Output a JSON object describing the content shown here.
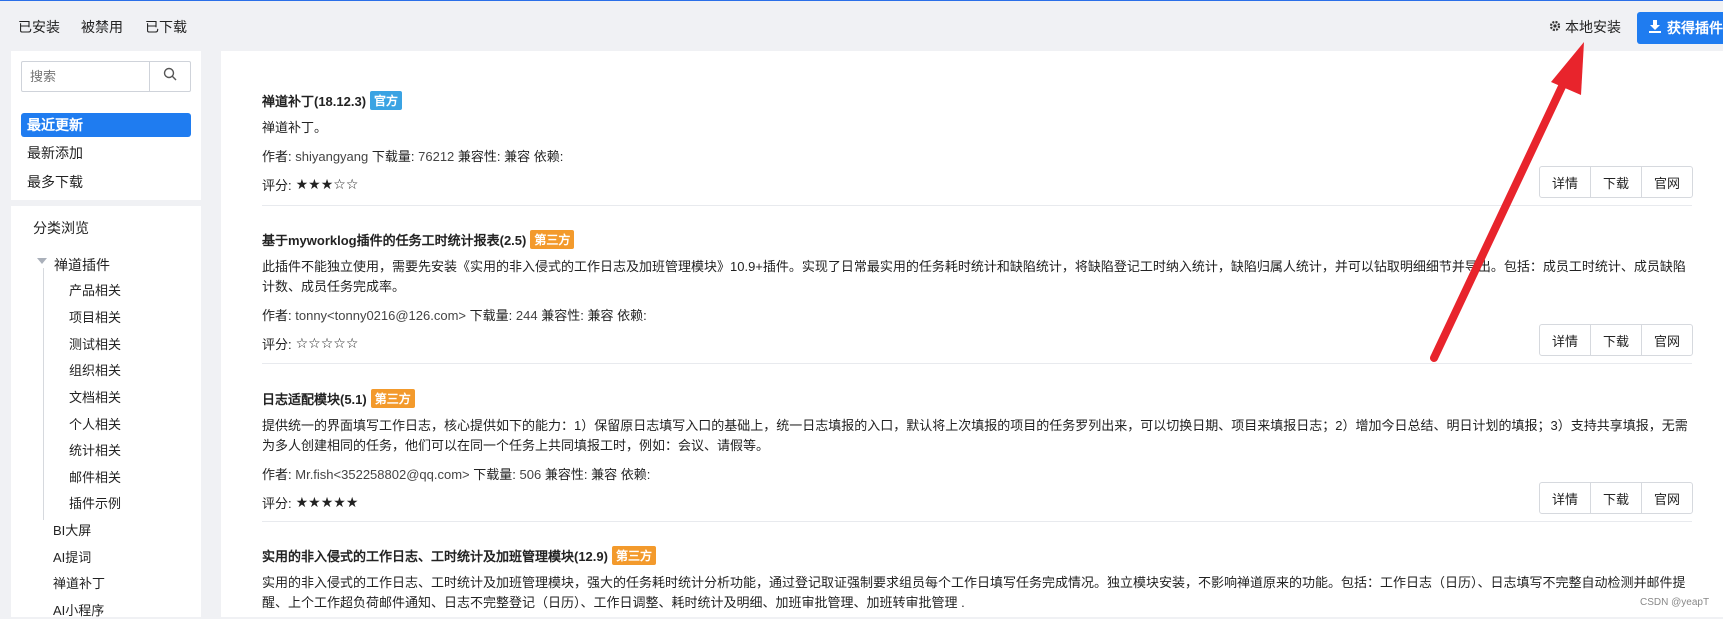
{
  "top_tabs": [
    "已安装",
    "被禁用",
    "已下载"
  ],
  "local_install_label": "本地安装",
  "get_plugin_label": "获得插件",
  "search": {
    "placeholder": "搜索"
  },
  "sort_nav": [
    "最近更新",
    "最新添加",
    "最多下载"
  ],
  "category": {
    "title": "分类浏览",
    "group": "禅道插件",
    "children": [
      "产品相关",
      "项目相关",
      "测试相关",
      "组织相关",
      "文档相关",
      "个人相关",
      "统计相关",
      "邮件相关",
      "插件示例"
    ],
    "others": [
      "BI大屏",
      "AI提词",
      "禅道补丁",
      "AI小程序"
    ]
  },
  "labels": {
    "author": "作者:",
    "downloads": "下载量:",
    "compat": "兼容性:",
    "deps": "依赖:",
    "rating": "评分:",
    "details": "详情",
    "download": "下载",
    "site": "官网"
  },
  "plugins": [
    {
      "title": "禅道补丁(18.12.3)",
      "badge": "官方",
      "desc": "禅道补丁。",
      "author": "shiyangyang",
      "downloads": "76212",
      "compat": "兼容",
      "stars": "★★★☆☆"
    },
    {
      "title": "基于myworklog插件的任务工时统计报表(2.5)",
      "badge": "第三方",
      "desc": "此插件不能独立使用，需要先安装《实用的非入侵式的工作日志及加班管理模块》10.9+插件。实现了日常最实用的任务耗时统计和缺陷统计，将缺陷登记工时纳入统计，缺陷归属人统计，并可以钻取明细细节并导出。包括：成员工时统计、成员缺陷计数、成员任务完成率。",
      "author": "tonny<tonny0216@126.com>",
      "downloads": "244",
      "compat": "兼容",
      "stars": "☆☆☆☆☆"
    },
    {
      "title": "日志适配模块(5.1)",
      "badge": "第三方",
      "desc": "提供统一的界面填写工作日志，核心提供如下的能力：1）保留原日志填写入口的基础上，统一日志填报的入口，默认将上次填报的项目的任务罗列出来，可以切换日期、项目来填报日志；2）增加今日总结、明日计划的填报；3）支持共享填报，无需为多人创建相同的任务，他们可以在同一个任务上共同填报工时，例如：会议、请假等。",
      "author": "Mr.fish<352258802@qq.com>",
      "downloads": "506",
      "compat": "兼容",
      "stars": "★★★★★"
    },
    {
      "title": "实用的非入侵式的工作日志、工时统计及加班管理模块(12.9)",
      "badge": "第三方",
      "desc": "实用的非入侵式的工作日志、工时统计及加班管理模块，强大的任务耗时统计分析功能，通过登记取证强制要求组员每个工作日填写任务完成情况。独立模块安装，不影响禅道原来的功能。包括：工作日志（日历）、日志填写不完整自动检测并邮件提醒、上个工作超负荷邮件通知、日志不完整登记（日历）、工作日调整、耗时统计及明细、加班审批管理、加班转审批管理 ."
    }
  ],
  "watermark": "CSDN @yeapT",
  "colors": {
    "primary": "#1f7cf0",
    "official": "#3aa3e3",
    "third": "#f39a2c",
    "arrow": "#e8242c"
  }
}
